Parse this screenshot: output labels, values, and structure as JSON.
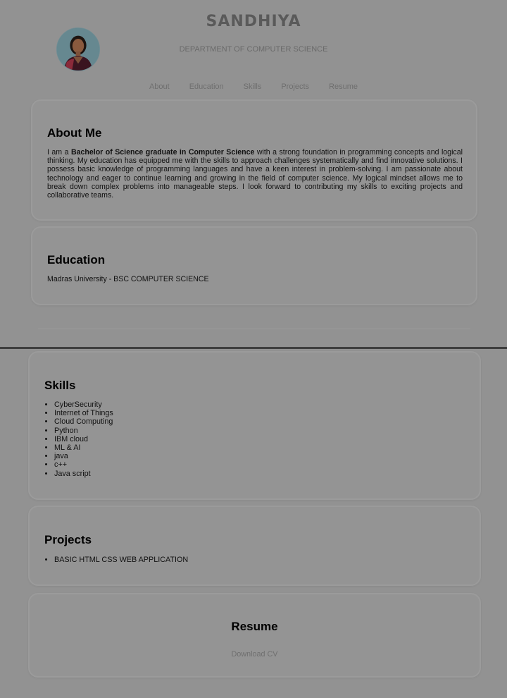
{
  "header": {
    "name": "SANDHIYA",
    "department": "DEPARTMENT OF COMPUTER SCIENCE"
  },
  "nav": {
    "items": [
      {
        "label": "About"
      },
      {
        "label": "Education"
      },
      {
        "label": "Skills"
      },
      {
        "label": "Projects"
      },
      {
        "label": "Resume"
      }
    ]
  },
  "about": {
    "heading": "About Me",
    "intro": "I am a ",
    "highlight": "Bachelor of Science graduate in Computer Science",
    "body": " with a strong foundation in programming concepts and logical thinking. My education has equipped me with the skills to approach challenges systematically and find innovative solutions. I possess basic knowledge of programming languages and have a keen interest in problem-solving. I am passionate about technology and eager to continue learning and growing in the field of computer science. My logical mindset allows me to break down complex problems into manageable steps. I look forward to contributing my skills to exciting projects and collaborative teams."
  },
  "education": {
    "heading": "Education",
    "entry": "Madras University - BSC COMPUTER SCIENCE"
  },
  "skills": {
    "heading": "Skills",
    "items": [
      "CyberSecurity",
      "Internet of Things",
      "Cloud Computing",
      "Python",
      "IBM cloud",
      "ML & AI",
      "java",
      "c++",
      "Java script"
    ]
  },
  "projects": {
    "heading": "Projects",
    "items": [
      "BASIC HTML CSS WEB APPLICATION"
    ]
  },
  "resume": {
    "heading": "Resume",
    "download_label": "Download CV"
  },
  "colors": {
    "background": "#929292",
    "card_border": "#9b9b9b",
    "page_break": "#3e3e3e",
    "muted_text": "#6e6e6e"
  }
}
